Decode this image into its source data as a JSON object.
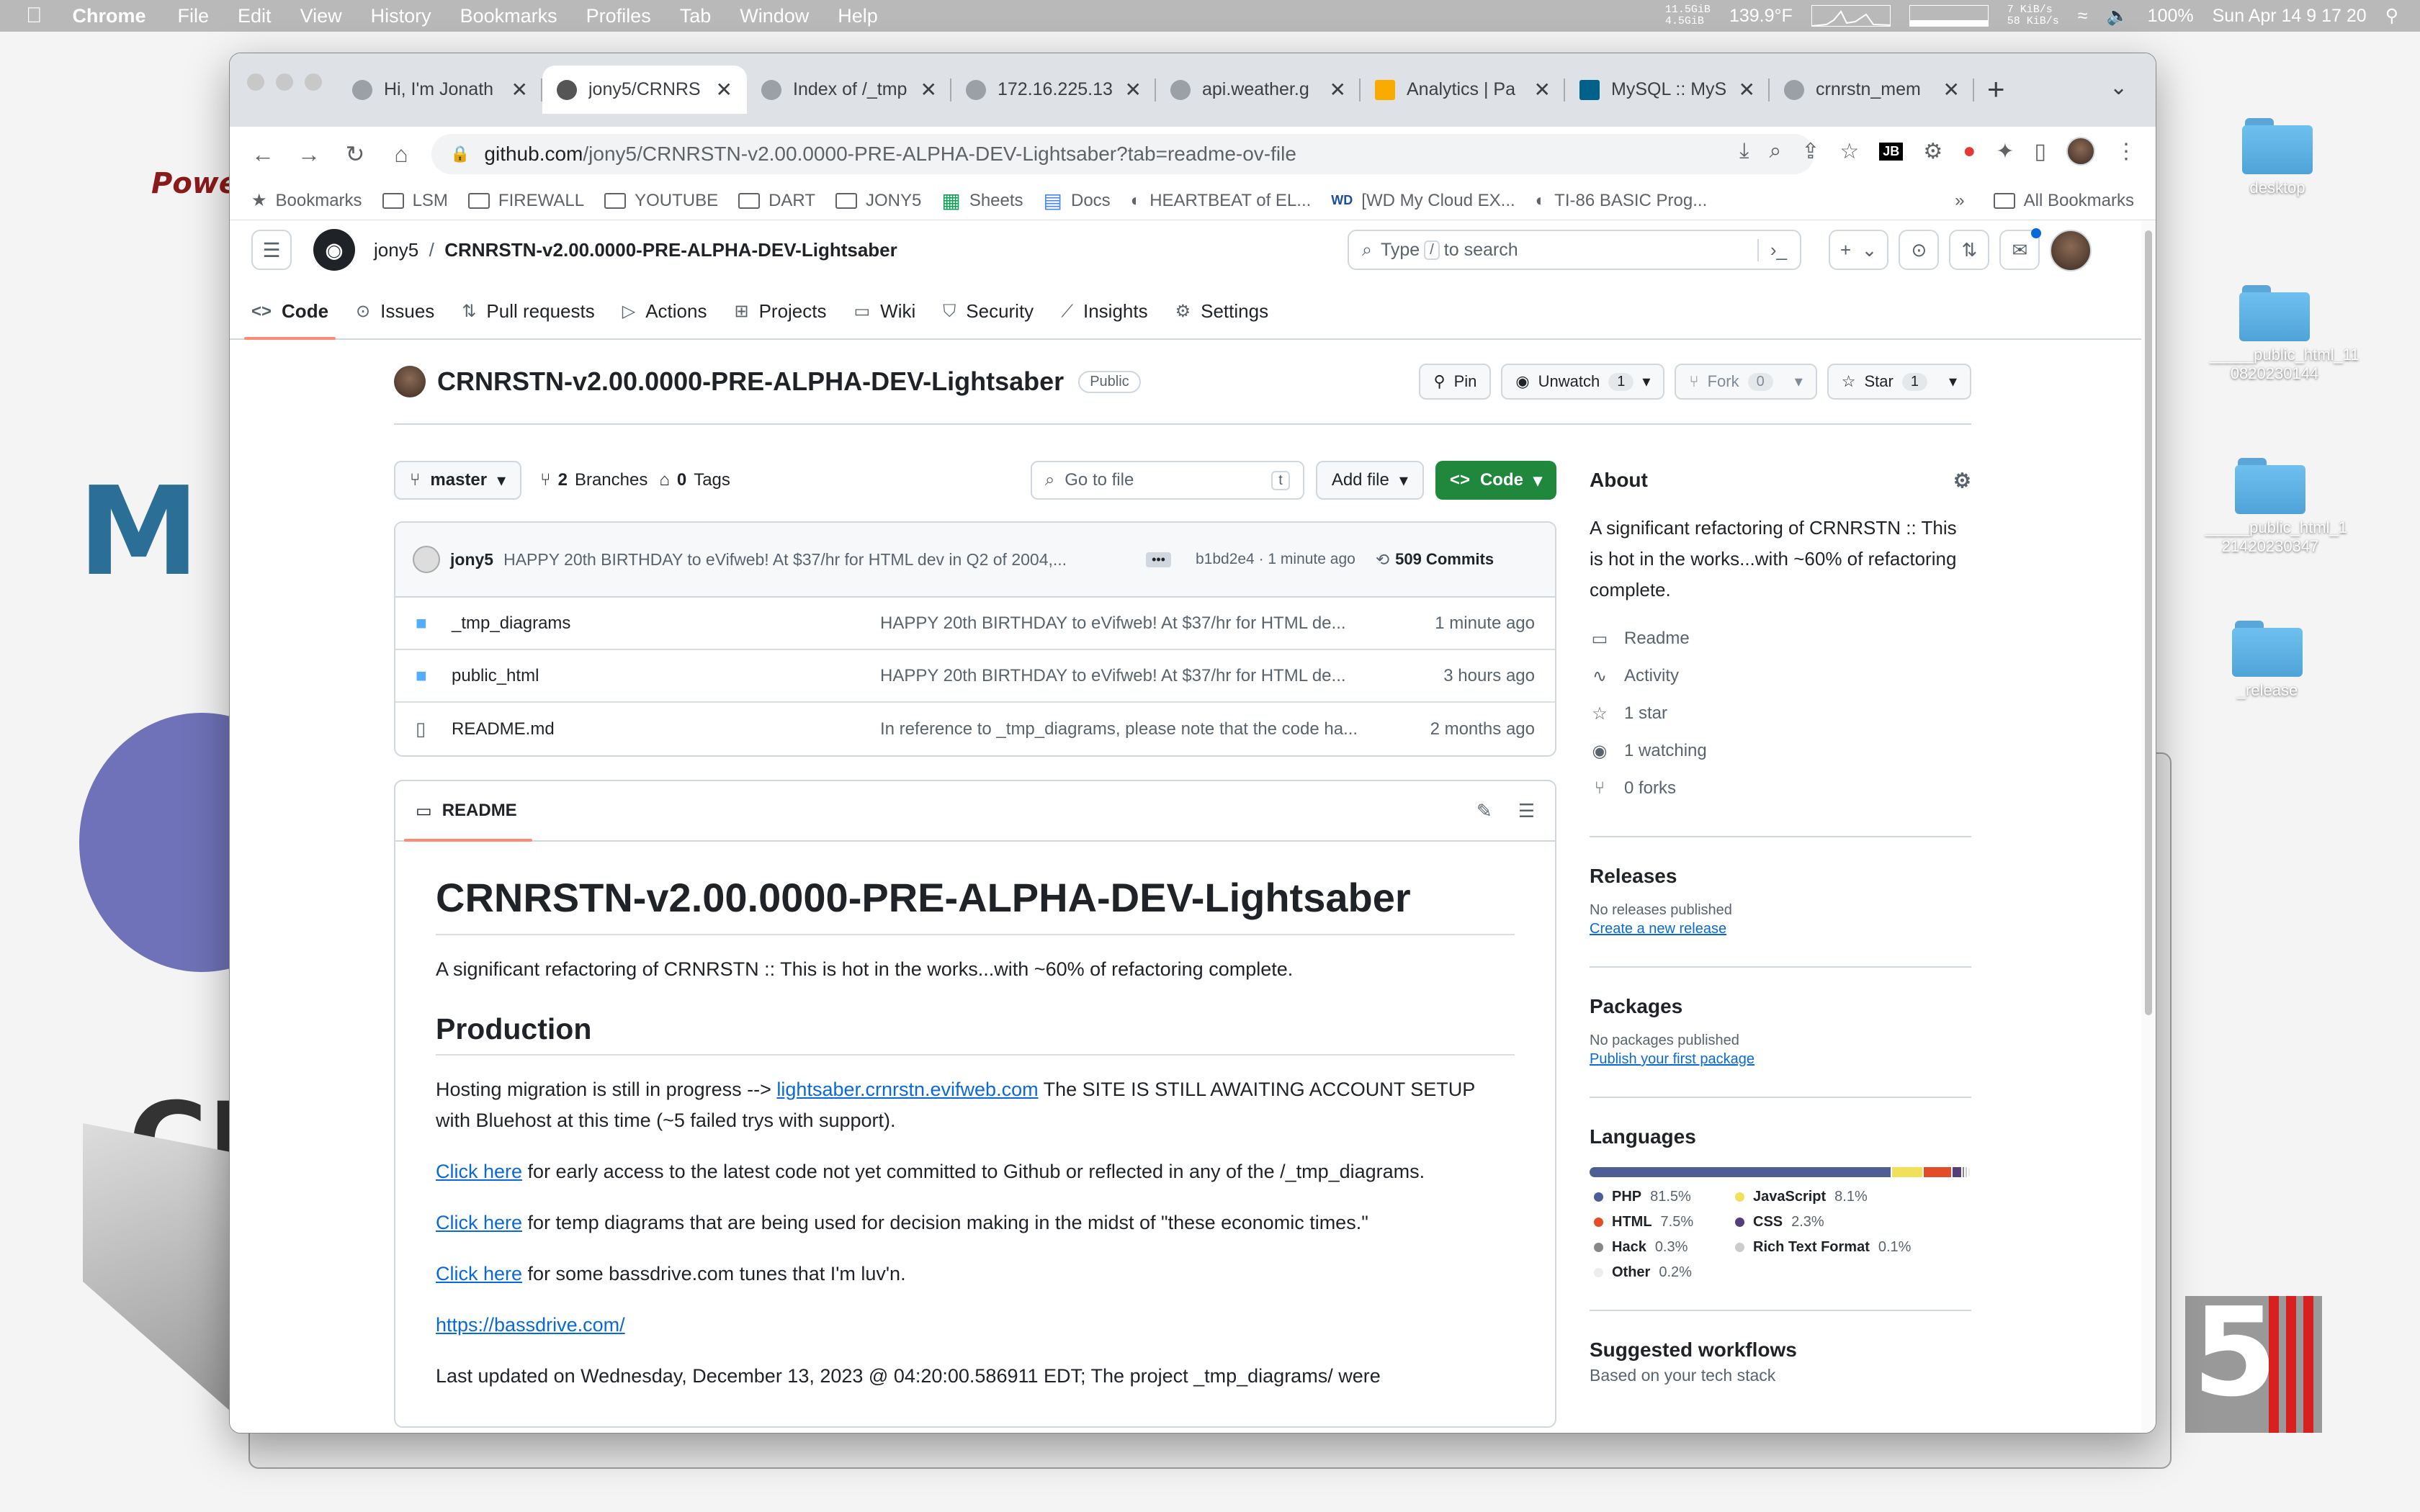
{
  "menubar": {
    "app": "Chrome",
    "items": [
      "File",
      "Edit",
      "View",
      "History",
      "Bookmarks",
      "Profiles",
      "Tab",
      "Window",
      "Help"
    ],
    "mem_u": "11.5GiB",
    "mem_f": "4.5GiB",
    "temp": "139.9°F",
    "net_up": "7 KiB/s",
    "net_down": "58 KiB/s",
    "battery": "100%",
    "datetime": "Sun Apr 14  9 17 20"
  },
  "desktop": {
    "icons": [
      {
        "label": "desktop"
      },
      {
        "label": "_____public_html_11 0820230144"
      },
      {
        "label": "_____public_html_1 21420230347"
      },
      {
        "label": "_release"
      }
    ],
    "bg_text": [
      "Powe",
      "M",
      "CF",
      "5"
    ]
  },
  "browser": {
    "tabs": [
      {
        "title": "Hi, I'm Jonath",
        "active": false
      },
      {
        "title": "jony5/CRNRS",
        "active": true
      },
      {
        "title": "Index of /_tmp",
        "active": false
      },
      {
        "title": "172.16.225.13",
        "active": false
      },
      {
        "title": "api.weather.g",
        "active": false
      },
      {
        "title": "Analytics | Pa",
        "active": false
      },
      {
        "title": "MySQL :: MyS",
        "active": false
      },
      {
        "title": "crnrstn_mem",
        "active": false
      }
    ],
    "url_host": "github.com",
    "url_path": "/jony5/CRNRSTN-v2.00.0000-PRE-ALPHA-DEV-Lightsaber?tab=readme-ov-file",
    "bookmarks": [
      "Bookmarks",
      "LSM",
      "FIREWALL",
      "YOUTUBE",
      "DART",
      "JONY5",
      "Sheets",
      "Docs",
      "HEARTBEAT of EL...",
      "[WD My Cloud EX...",
      "TI-86 BASIC Prog..."
    ],
    "all_bookmarks": "All Bookmarks",
    "more": "»"
  },
  "github": {
    "owner": "jony5",
    "repo": "CRNRSTN-v2.00.0000-PRE-ALPHA-DEV-Lightsaber",
    "search_pre": "Type",
    "search_key": "/",
    "search_post": "to search",
    "nav": [
      "Code",
      "Issues",
      "Pull requests",
      "Actions",
      "Projects",
      "Wiki",
      "Security",
      "Insights",
      "Settings"
    ],
    "visibility": "Public",
    "pin": "Pin",
    "unwatch": "Unwatch",
    "unwatch_count": "1",
    "fork": "Fork",
    "fork_count": "0",
    "star": "Star",
    "star_count": "1",
    "branch": "master",
    "branches_count": "2",
    "branches_label": "Branches",
    "tags_count": "0",
    "tags_label": "Tags",
    "goto_placeholder": "Go to file",
    "goto_key": "t",
    "add_file": "Add file",
    "code_btn": "Code",
    "commit": {
      "author": "jony5",
      "message": "HAPPY 20th BIRTHDAY to eVifweb! At $37/hr for HTML dev in Q2 of 2004,...",
      "sha": "b1bd2e4 · 1 minute ago",
      "count": "509 Commits"
    },
    "files": [
      {
        "name": "_tmp_diagrams",
        "type": "folder",
        "message": "HAPPY 20th BIRTHDAY to eVifweb! At $37/hr for HTML de...",
        "time": "1 minute ago"
      },
      {
        "name": "public_html",
        "type": "folder",
        "message": "HAPPY 20th BIRTHDAY to eVifweb! At $37/hr for HTML de...",
        "time": "3 hours ago"
      },
      {
        "name": "README.md",
        "type": "file",
        "message": "In reference to _tmp_diagrams, please note that the code ha...",
        "time": "2 months ago"
      }
    ],
    "readme": {
      "tab": "README",
      "h1": "CRNRSTN-v2.00.0000-PRE-ALPHA-DEV-Lightsaber",
      "intro": "A significant refactoring of CRNRSTN :: This is hot in the works...with ~60% of refactoring complete.",
      "h2": "Production",
      "p1_pre": "Hosting migration is still in progress --> ",
      "p1_link": "lightsaber.crnrstn.evifweb.com",
      "p1_post": " The SITE IS STILL AWAITING ACCOUNT SETUP with Bluehost at this time (~5 failed trys with support).",
      "click_here": "Click here",
      "p2": " for early access to the latest code not yet committed to Github or reflected in any of the /_tmp_diagrams.",
      "p3": " for temp diagrams that are being used for decision making in the midst of \"these economic times.\"",
      "p4": " for some bassdrive.com tunes that I'm luv'n.",
      "p5_link": "https://bassdrive.com/",
      "p6": "Last updated on Wednesday, December 13, 2023 @ 04:20:00.586911 EDT; The project _tmp_diagrams/ were"
    },
    "about": {
      "title": "About",
      "description": "A significant refactoring of CRNRSTN :: This is hot in the works...with ~60% of refactoring complete.",
      "items": [
        "Readme",
        "Activity",
        "1 star",
        "1 watching",
        "0 forks"
      ]
    },
    "releases": {
      "title": "Releases",
      "none": "No releases published",
      "link": "Create a new release"
    },
    "packages": {
      "title": "Packages",
      "none": "No packages published",
      "link": "Publish your first package"
    },
    "languages": {
      "title": "Languages",
      "list": [
        {
          "name": "PHP",
          "pct": "81.5%",
          "value": 81.5,
          "color": "#4F5D95"
        },
        {
          "name": "JavaScript",
          "pct": "8.1%",
          "value": 8.1,
          "color": "#f1e05a"
        },
        {
          "name": "HTML",
          "pct": "7.5%",
          "value": 7.5,
          "color": "#e34c26"
        },
        {
          "name": "CSS",
          "pct": "2.3%",
          "value": 2.3,
          "color": "#563d7c"
        },
        {
          "name": "Hack",
          "pct": "0.3%",
          "value": 0.3,
          "color": "#878787"
        },
        {
          "name": "Rich Text Format",
          "pct": "0.1%",
          "value": 0.1,
          "color": "#cccccc"
        },
        {
          "name": "Other",
          "pct": "0.2%",
          "value": 0.2,
          "color": "#ededed"
        }
      ]
    },
    "workflows": {
      "title": "Suggested workflows",
      "sub": "Based on your tech stack"
    }
  }
}
